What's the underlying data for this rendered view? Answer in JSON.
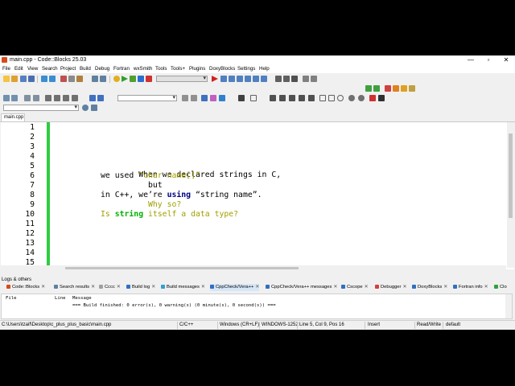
{
  "window": {
    "title": "main.cpp - Code::Blocks 25.03",
    "minimize": "—",
    "maximize": "▫",
    "close": "✕"
  },
  "menu": [
    "File",
    "Edit",
    "View",
    "Search",
    "Project",
    "Build",
    "Debug",
    "Fortran",
    "wxSmith",
    "Tools",
    "Tools+",
    "Plugins",
    "DoxyBlocks",
    "Settings",
    "Help"
  ],
  "editor_tab": "main.cpp",
  "line_numbers": [
    "1",
    "2",
    "3",
    "4",
    "5",
    "6",
    "7",
    "8",
    "9",
    "10",
    "11",
    "12",
    "13",
    "14",
    "15"
  ],
  "code": {
    "l5a": "When we declared strings in C,",
    "l6a": "we used ",
    "l6b": "“char name[]”",
    "l7a": "          but",
    "l8a": "in C++, we’re ",
    "l8b": "using",
    "l8c": " “string name”.",
    "l9a": "          Why so?",
    "l10a": "Is ",
    "l10b": "string",
    "l10c": " itself a data type?"
  },
  "logs": {
    "title": "Logs & others",
    "tabs": [
      "Code::Blocks",
      "Search results",
      "Cccc",
      "Build log",
      "Build messages",
      "CppCheck/Vera++",
      "CppCheck/Vera++ messages",
      "Cscope",
      "Debugger",
      "DoxyBlocks",
      "Fortran info",
      "Clo"
    ],
    "col_file": "File",
    "col_line": "Line",
    "col_message": "Message",
    "message": "=== Build finished: 0 error(s), 0 warning(s) (0 minute(s), 0 second(s)) ==="
  },
  "status": {
    "path": "C:\\Users\\tzaif\\Desktop\\c_plus_plus_basic\\main.cpp",
    "language": "C/C++",
    "eol": "Windows (CR+LF)",
    "encoding": "WINDOWS-1252",
    "position": "Line 5, Col 9, Pos 16",
    "mode": "Insert",
    "access": "Read/Write",
    "profile": "default"
  }
}
